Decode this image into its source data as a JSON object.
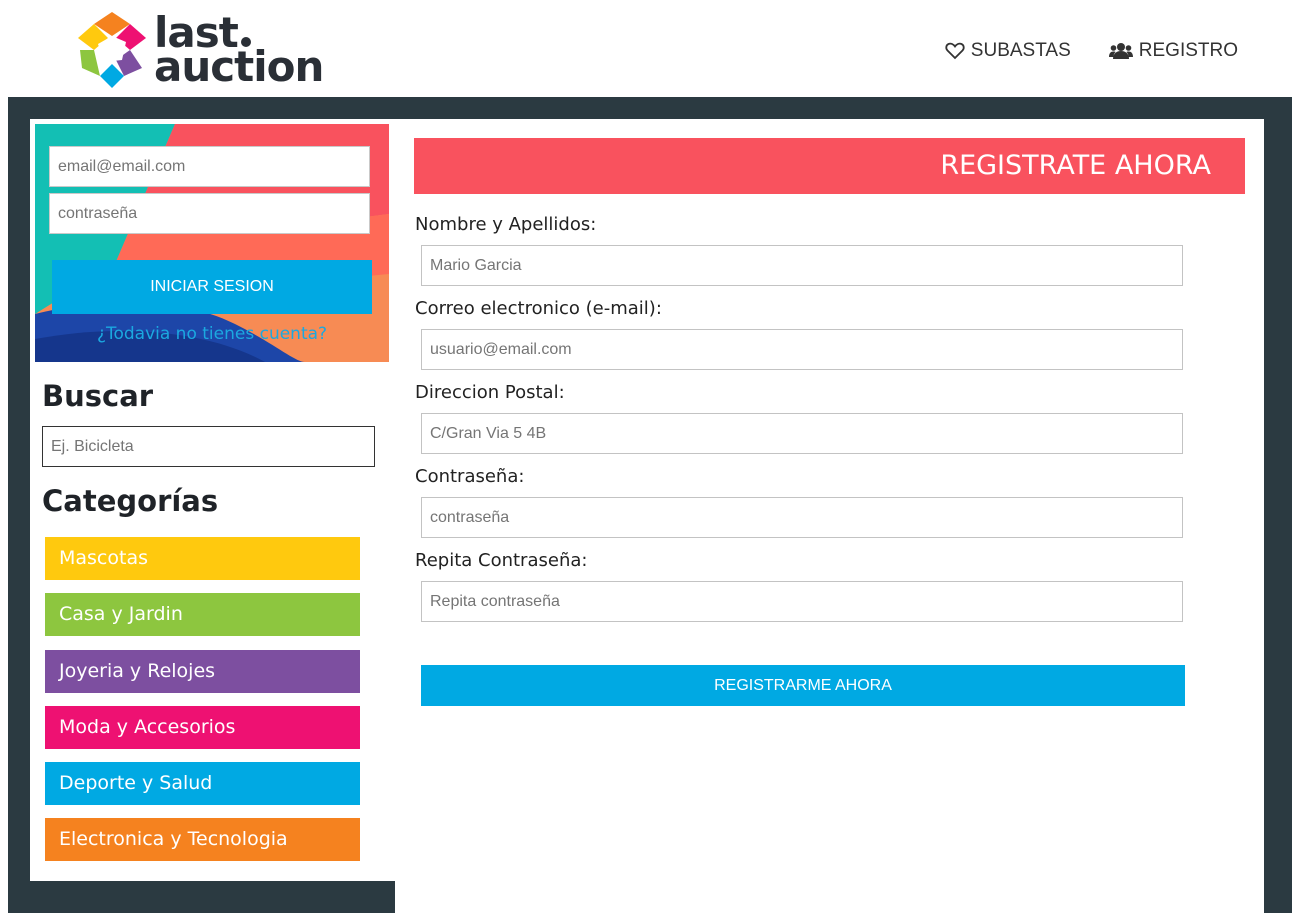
{
  "header": {
    "logo": {
      "line1": "last",
      "line2": "auction"
    },
    "nav": [
      {
        "label": "SUBASTAS",
        "icon": "heart-icon"
      },
      {
        "label": "REGISTRO",
        "icon": "users-icon"
      }
    ]
  },
  "login": {
    "email_placeholder": "email@email.com",
    "password_placeholder": "contraseña",
    "button_label": "INICIAR SESION",
    "signup_link": "¿Todavia no tienes cuenta?"
  },
  "search": {
    "heading": "Buscar",
    "placeholder": "Ej. Bicicleta"
  },
  "categories": {
    "heading": "Categorías",
    "items": [
      {
        "label": "Mascotas",
        "color": "#ffc90e"
      },
      {
        "label": "Casa y Jardin",
        "color": "#8dc63f"
      },
      {
        "label": "Joyeria y Relojes",
        "color": "#7d4fa0"
      },
      {
        "label": "Moda y Accesorios",
        "color": "#ee1172"
      },
      {
        "label": "Deporte y Salud",
        "color": "#00a9e3"
      },
      {
        "label": "Electronica y Tecnologia",
        "color": "#f5821f"
      }
    ]
  },
  "register": {
    "title": "REGISTRATE AHORA",
    "fields": [
      {
        "label": "Nombre y Apellidos:",
        "placeholder": "Mario Garcia"
      },
      {
        "label": "Correo electronico (e-mail):",
        "placeholder": "usuario@email.com"
      },
      {
        "label": "Direccion Postal:",
        "placeholder": "C/Gran Via 5 4B"
      },
      {
        "label": "Contraseña:",
        "placeholder": "contraseña"
      },
      {
        "label": "Repita Contraseña:",
        "placeholder": "Repita contraseña"
      }
    ],
    "button_label": "REGISTRARME AHORA"
  },
  "colors": {
    "accent_blue": "#00a9e3",
    "banner_red": "#f9525e",
    "dark_band": "#2b3a41"
  }
}
